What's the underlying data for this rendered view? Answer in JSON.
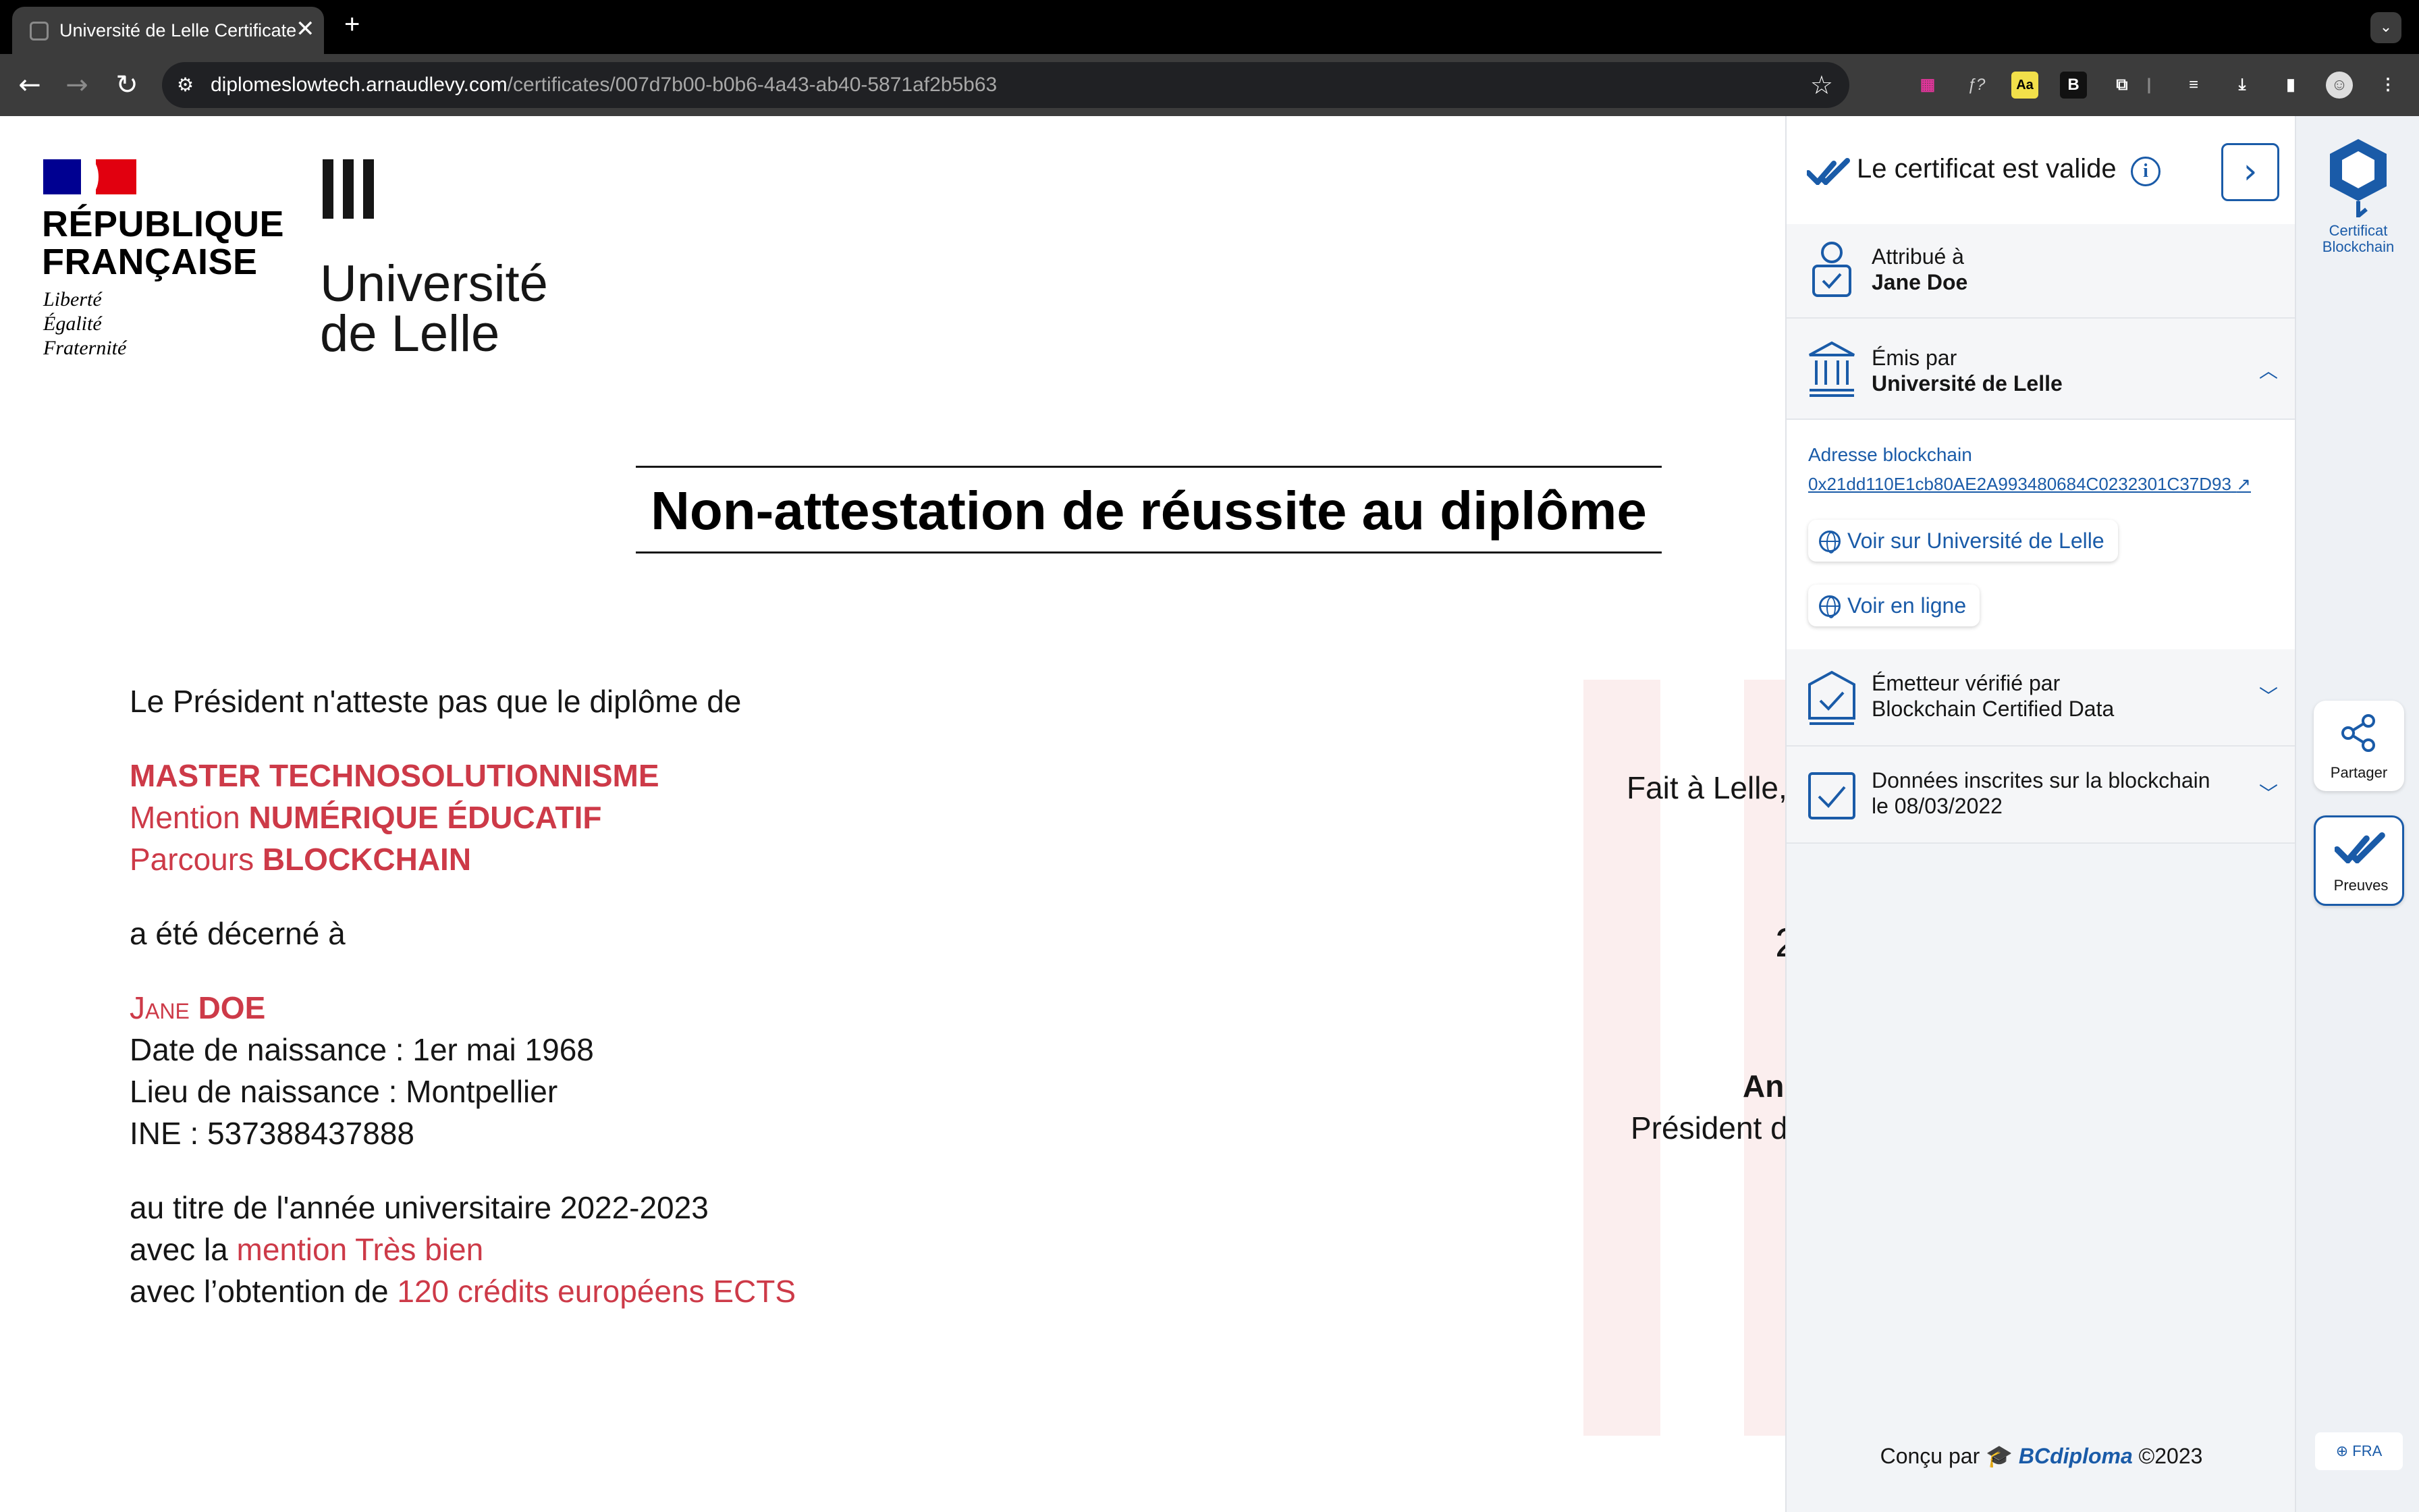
{
  "browser": {
    "tab_title": "Université de Lelle Certificate",
    "tab_close": "✕",
    "new_tab": "+",
    "url_host": "diplomeslowtech.arnaudlevy.com",
    "url_path": "/certificates/007d7b00-b0b6-4a43-ab40-5871af2b5b63",
    "extensions": [
      "grid-icon",
      "function-icon",
      "dictionary-icon",
      "bold-b-icon",
      "puzzle-icon",
      "playlist-icon",
      "download-icon",
      "sidepanel-icon",
      "profile-icon",
      "more-icon"
    ],
    "ext_fx": "ƒ?",
    "ext_aa": "Aa",
    "ext_b": "B"
  },
  "header": {
    "republic_name": "RÉPUBLIQUE\nFRANÇAISE",
    "republic_motto": "Liberté\nÉgalité\nFraternité",
    "university_name": "Université\nde Lelle"
  },
  "certificate": {
    "title": "Non-attestation de réussite au diplôme",
    "intro": "Le Président n'atteste pas que le diplôme de",
    "degree": "MASTER TECHNOSOLUTIONNISME",
    "mention_prefix": "Mention ",
    "mention": "NUMÉRIQUE ÉDUCATIF",
    "parcours_prefix": "Parcours ",
    "parcours": "BLOCKCHAIN",
    "awarded": "a été décerné à",
    "first_name": "Jane",
    "last_name": "DOE",
    "birth_date": "Date de naissance : 1er mai 1968",
    "birth_place": "Lieu de naissance : Montpellier",
    "ine": "INE : 537388437888",
    "year_line": "au titre de l'année universitaire 2022-2023",
    "honors_prefix": "avec la ",
    "honors": "mention Très bien",
    "credits_prefix": "avec l’obtention de ",
    "credits": "120 crédits européens ECTS",
    "place_date": "Fait à Lelle,",
    "digit_fragment": "2",
    "signer_fragment": "An",
    "signer_title_fragment": "Président d"
  },
  "panel": {
    "valid_text": "Le certificat est valide",
    "attributed_label": "Attribué à",
    "attributed_value": "Jane Doe",
    "issued_label": "Émis par",
    "issued_value": "Université de Lelle",
    "address_label": "Adresse  blockchain",
    "address_value": "0x21dd110E1cb80AE2A993480684C0232301C37D93",
    "view_issuer": "Voir sur Université de Lelle",
    "view_online": "Voir en ligne",
    "verified_label": "Émetteur vérifié par",
    "verified_value": "Blockchain Certified Data",
    "data_label": "Données inscrites sur la blockchain",
    "data_value": " le 08/03/2022",
    "footer_prefix": "Conçu par",
    "footer_brand": "BCdiploma",
    "footer_year": "©2023"
  },
  "rail": {
    "logo_label": "Certificat\nBlockchain",
    "share_label": "Partager",
    "proofs_label": "Preuves",
    "language": "FRA"
  },
  "colors": {
    "accent_blue": "#1a5ba8",
    "certificate_red": "#cd3a48",
    "republic_blue": "#000091",
    "republic_red": "#e1000f"
  }
}
